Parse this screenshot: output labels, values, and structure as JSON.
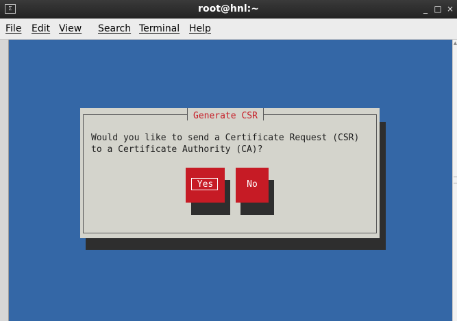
{
  "window": {
    "title": "root@hnl:~",
    "app_icon_glyph": "Σ",
    "controls": {
      "minimize": "_",
      "maximize": "□",
      "close": "×"
    }
  },
  "menubar": {
    "items": [
      {
        "label": "File"
      },
      {
        "label": "Edit"
      },
      {
        "label": "View"
      },
      {
        "label": "Search"
      },
      {
        "label": "Terminal"
      },
      {
        "label": "Help"
      }
    ]
  },
  "terminal": {
    "background_color": "#3467a6"
  },
  "dialog": {
    "title": "Generate CSR",
    "lines": [
      "Would you like to send a Certificate Request (CSR)",
      "to a Certificate Authority (CA)?"
    ],
    "buttons": {
      "yes": "Yes",
      "no": "No",
      "focused": "Yes"
    },
    "accent_color": "#c61b25"
  }
}
